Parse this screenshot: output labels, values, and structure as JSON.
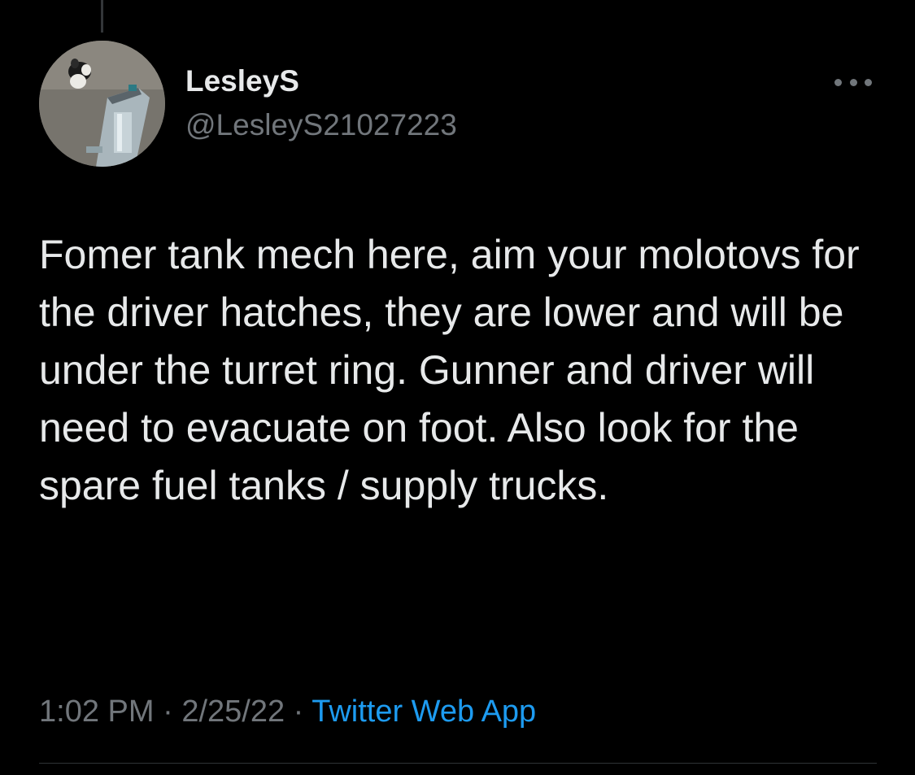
{
  "tweet": {
    "author": {
      "display_name": "LesleyS",
      "handle": "@LesleyS21027223"
    },
    "text": "Fomer tank mech here, aim your molotovs for the driver hatches, they are lower and will be under the turret ring. Gunner and driver will need to evacuate on foot. Also look for the spare fuel tanks / supply trucks.",
    "time": "1:02 PM",
    "separator": "·",
    "date": "2/25/22",
    "source": "Twitter Web App"
  },
  "icons": {
    "more": "more-horizontal-icon"
  },
  "colors": {
    "background": "#000000",
    "text_primary": "#e7e9ea",
    "text_secondary": "#71767b",
    "link": "#1d9bf0",
    "divider": "#2f3336"
  }
}
